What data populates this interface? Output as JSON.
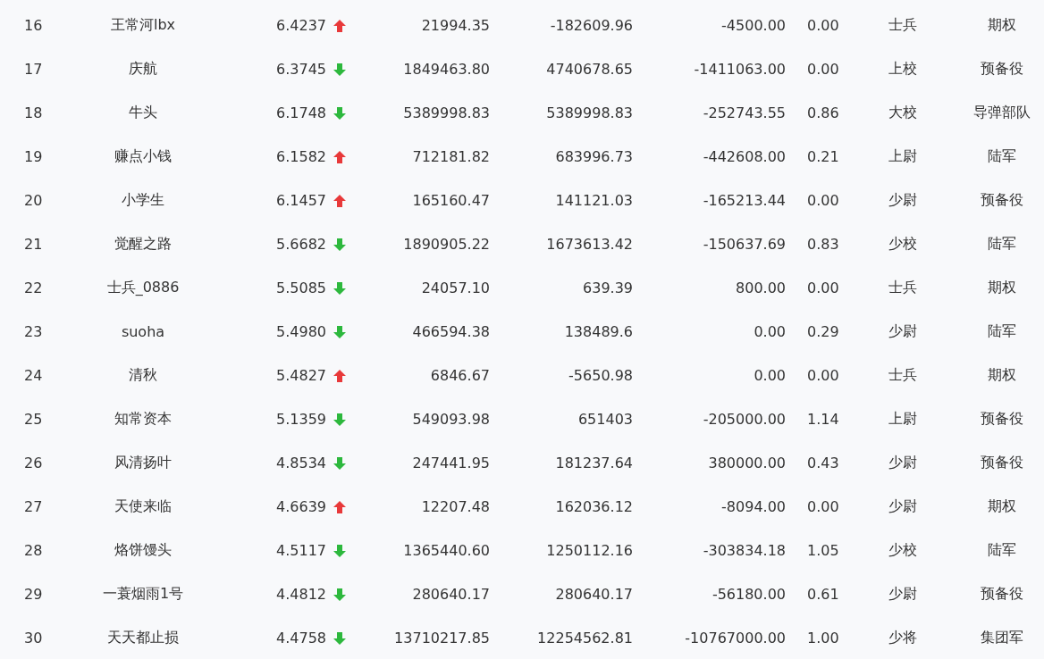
{
  "rows": [
    {
      "rank": "16",
      "name": "王常河lbx",
      "score": "6.4237",
      "up": true,
      "column_4": "21994.35",
      "column_5": "-182609.96",
      "column_6": "-4500.00",
      "column_7": "0.00",
      "rank_title": "士兵",
      "group": "期权"
    },
    {
      "rank": "17",
      "name": "庆航",
      "score": "6.3745",
      "up": false,
      "column_4": "1849463.80",
      "column_5": "4740678.65",
      "column_6": "-1411063.00",
      "column_7": "0.00",
      "rank_title": "上校",
      "group": "预备役"
    },
    {
      "rank": "18",
      "name": "牛头",
      "score": "6.1748",
      "up": false,
      "column_4": "5389998.83",
      "column_5": "5389998.83",
      "column_6": "-252743.55",
      "column_7": "0.86",
      "rank_title": "大校",
      "group": "导弹部队"
    },
    {
      "rank": "19",
      "name": "赚点小钱",
      "score": "6.1582",
      "up": true,
      "column_4": "712181.82",
      "column_5": "683996.73",
      "column_6": "-442608.00",
      "column_7": "0.21",
      "rank_title": "上尉",
      "group": "陆军"
    },
    {
      "rank": "20",
      "name": "小学生",
      "score": "6.1457",
      "up": true,
      "column_4": "165160.47",
      "column_5": "141121.03",
      "column_6": "-165213.44",
      "column_7": "0.00",
      "rank_title": "少尉",
      "group": "预备役"
    },
    {
      "rank": "21",
      "name": "觉醒之路",
      "score": "5.6682",
      "up": false,
      "column_4": "1890905.22",
      "column_5": "1673613.42",
      "column_6": "-150637.69",
      "column_7": "0.83",
      "rank_title": "少校",
      "group": "陆军"
    },
    {
      "rank": "22",
      "name": "士兵_0886",
      "score": "5.5085",
      "up": false,
      "column_4": "24057.10",
      "column_5": "639.39",
      "column_6": "800.00",
      "column_7": "0.00",
      "rank_title": "士兵",
      "group": "期权"
    },
    {
      "rank": "23",
      "name": "suoha",
      "score": "5.4980",
      "up": false,
      "column_4": "466594.38",
      "column_5": "138489.6",
      "column_6": "0.00",
      "column_7": "0.29",
      "rank_title": "少尉",
      "group": "陆军"
    },
    {
      "rank": "24",
      "name": "清秋",
      "score": "5.4827",
      "up": true,
      "column_4": "6846.67",
      "column_5": "-5650.98",
      "column_6": "0.00",
      "column_7": "0.00",
      "rank_title": "士兵",
      "group": "期权"
    },
    {
      "rank": "25",
      "name": "知常资本",
      "score": "5.1359",
      "up": false,
      "column_4": "549093.98",
      "column_5": "651403",
      "column_6": "-205000.00",
      "column_7": "1.14",
      "rank_title": "上尉",
      "group": "预备役"
    },
    {
      "rank": "26",
      "name": "风清扬叶",
      "score": "4.8534",
      "up": false,
      "column_4": "247441.95",
      "column_5": "181237.64",
      "column_6": "380000.00",
      "column_7": "0.43",
      "rank_title": "少尉",
      "group": "预备役"
    },
    {
      "rank": "27",
      "name": "天使来临",
      "score": "4.6639",
      "up": true,
      "column_4": "12207.48",
      "column_5": "162036.12",
      "column_6": "-8094.00",
      "column_7": "0.00",
      "rank_title": "少尉",
      "group": "期权"
    },
    {
      "rank": "28",
      "name": "烙饼馒头",
      "score": "4.5117",
      "up": false,
      "column_4": "1365440.60",
      "column_5": "1250112.16",
      "column_6": "-303834.18",
      "column_7": "1.05",
      "rank_title": "少校",
      "group": "陆军"
    },
    {
      "rank": "29",
      "name": "一蓑烟雨1号",
      "score": "4.4812",
      "up": false,
      "column_4": "280640.17",
      "column_5": "280640.17",
      "column_6": "-56180.00",
      "column_7": "0.61",
      "rank_title": "少尉",
      "group": "预备役"
    },
    {
      "rank": "30",
      "name": "天天都止损",
      "score": "4.4758",
      "up": false,
      "column_4": "13710217.85",
      "column_5": "12254562.81",
      "column_6": "-10767000.00",
      "column_7": "1.00",
      "rank_title": "少将",
      "group": "集团军"
    }
  ]
}
